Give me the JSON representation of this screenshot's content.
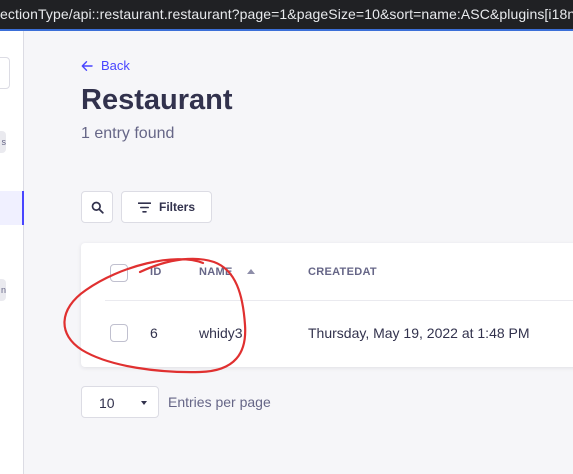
{
  "browser": {
    "url_fragment": "ectionType/api::restaurant.restaurant?page=1&pageSize=10&sort=name:ASC&plugins[i18n"
  },
  "sidebar": {
    "chip_1": "s",
    "chip_2": "n"
  },
  "header": {
    "back_label": "Back",
    "title": "Restaurant",
    "subtitle": "1 entry found"
  },
  "toolbar": {
    "filters_label": "Filters"
  },
  "table": {
    "columns": [
      "ID",
      "NAME",
      "CREATEDAT"
    ],
    "sort": {
      "column": "NAME",
      "direction": "ASC"
    },
    "rows": [
      {
        "id": "6",
        "name": "whidy3",
        "createdAt": "Thursday, May 19, 2022 at 1:48 PM"
      }
    ]
  },
  "pagination": {
    "page_size": "10",
    "per_page_label": "Entries per page"
  },
  "colors": {
    "accent": "#4945ff",
    "annotation": "#e03030",
    "background": "#f6f6f9"
  }
}
